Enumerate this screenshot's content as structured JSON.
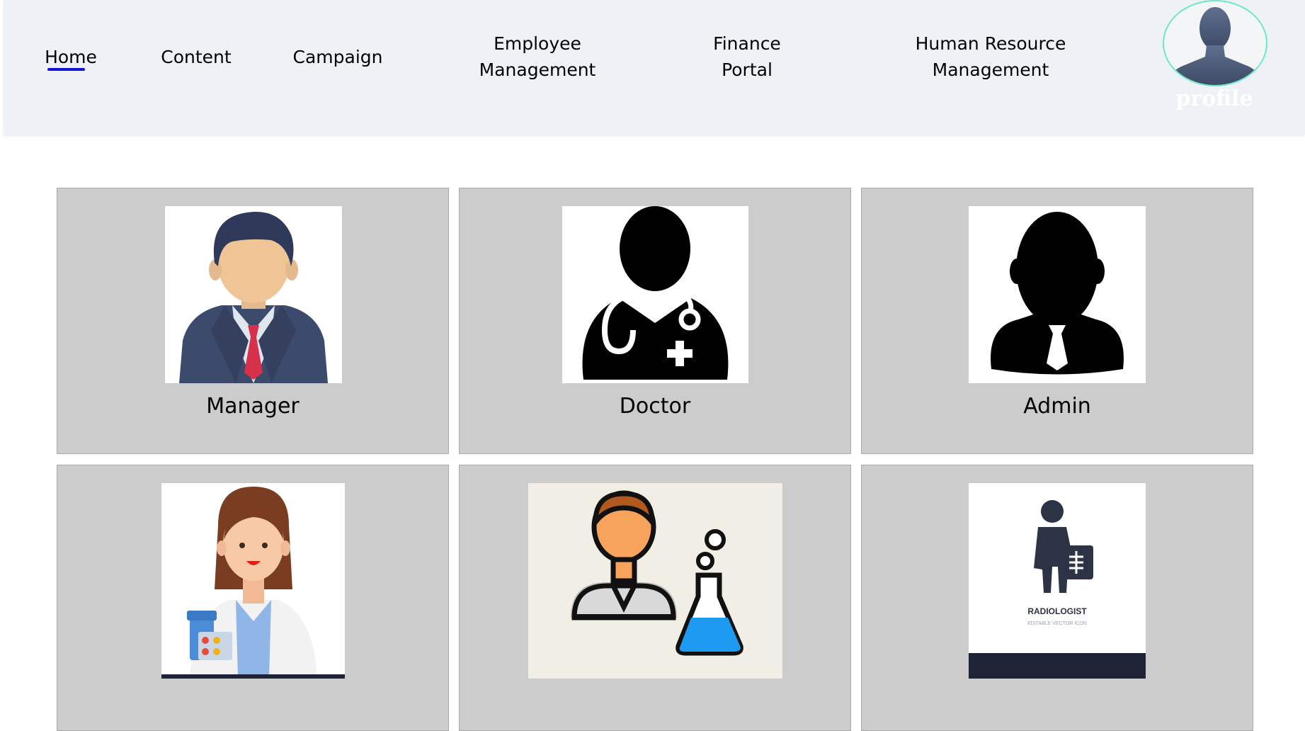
{
  "nav": {
    "home": "Home",
    "content": "Content",
    "campaign": "Campaign",
    "employee_management": "Employee\nManagement",
    "finance_portal": "Finance\nPortal",
    "hr_management": "Human Resource\nManagement"
  },
  "profile": {
    "label": "profile"
  },
  "cards": [
    {
      "label": "Manager",
      "icon": "manager-icon"
    },
    {
      "label": "Doctor",
      "icon": "doctor-icon"
    },
    {
      "label": "Admin",
      "icon": "admin-icon"
    },
    {
      "label": "",
      "icon": "pharmacist-icon"
    },
    {
      "label": "",
      "icon": "lab-technician-icon"
    },
    {
      "label": "",
      "icon": "radiologist-icon"
    }
  ],
  "radiologist_icon": {
    "title": "RADIOLOGIST",
    "subtitle": "EDITABLE VECTOR ICON"
  },
  "colors": {
    "nav_bg": "#eef2f6",
    "active_underline": "#1414d4",
    "card_bg": "#cccccc",
    "profile_ring": "#6ee7c8"
  }
}
